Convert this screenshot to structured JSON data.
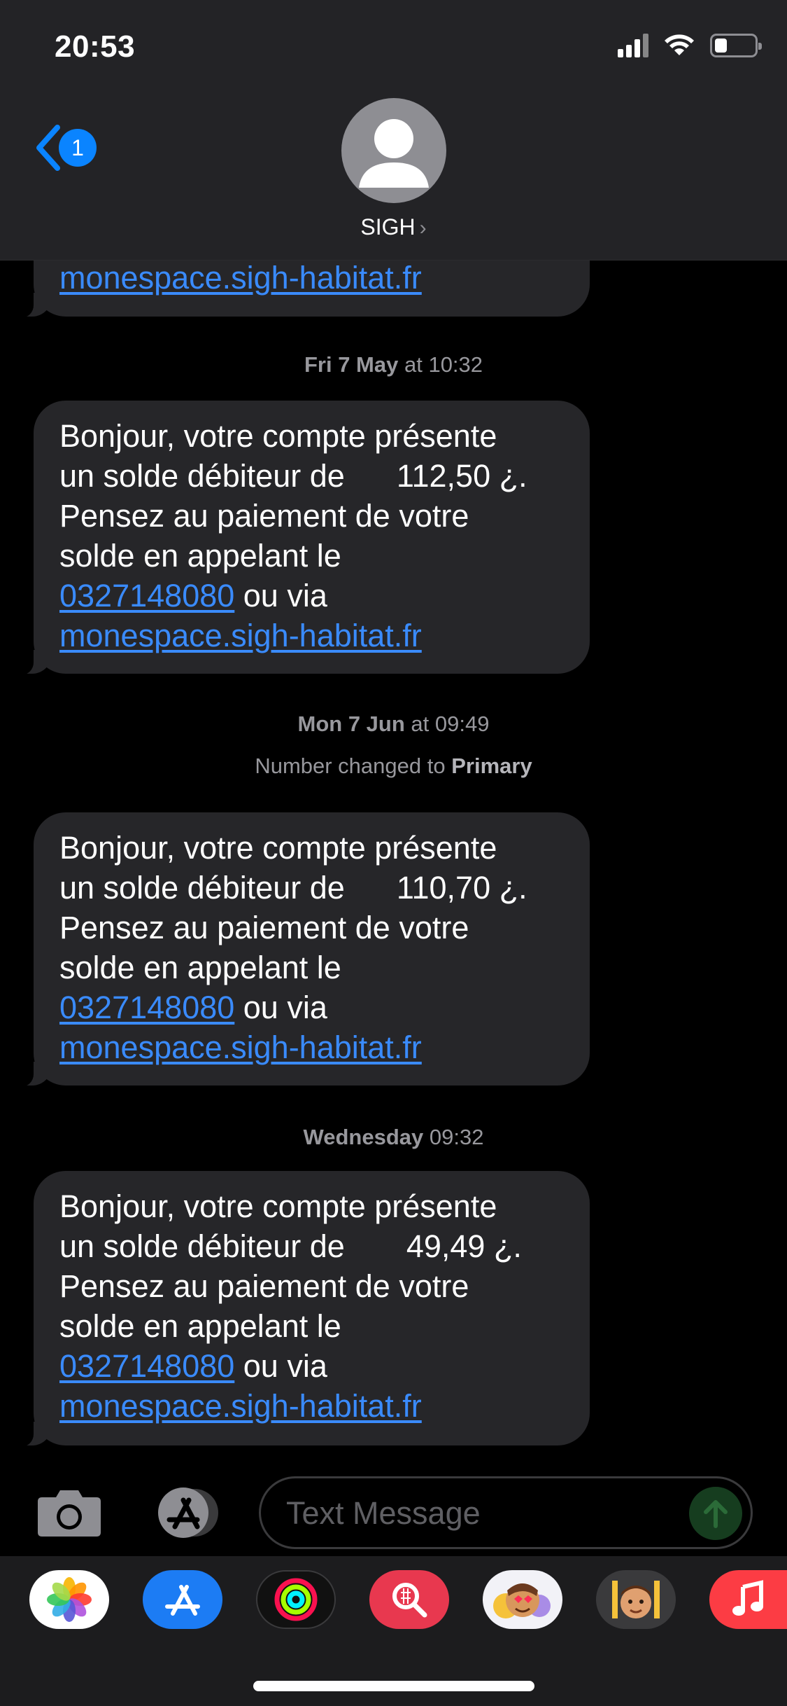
{
  "status_bar": {
    "time": "20:53",
    "icons": [
      "cellular-signal-icon",
      "wifi-icon",
      "battery-icon"
    ],
    "battery_level_fraction": 0.3
  },
  "nav": {
    "back_icon": "chevron-left-icon",
    "unread_badge": "1",
    "contact_name": "SIGH",
    "contact_chevron": "›"
  },
  "conversation": {
    "partial_top": {
      "link_site": "monespace.sigh-habitat.fr"
    },
    "groups": [
      {
        "timestamp_day": "Fri 7 May",
        "timestamp_at": " at ",
        "timestamp_time": "10:32",
        "message": {
          "line1": "Bonjour, votre compte présente",
          "line2_prefix": "un solde débiteur de",
          "amount": "112,50 ¿.",
          "line3": "Pensez au paiement de votre",
          "line4": "solde en appelant le",
          "phone": "0327148080",
          "ou_via": " ou via",
          "site": "monespace.sigh-habitat.fr"
        }
      },
      {
        "timestamp_day": "Mon 7 Jun",
        "timestamp_at": " at ",
        "timestamp_time": "09:49",
        "note_prefix": "Number changed to ",
        "note_value": "Primary",
        "message": {
          "line1": "Bonjour, votre compte présente",
          "line2_prefix": "un solde débiteur de",
          "amount": "110,70 ¿.",
          "line3": "Pensez au paiement de votre",
          "line4": "solde en appelant le",
          "phone": "0327148080",
          "ou_via": " ou via",
          "site": "monespace.sigh-habitat.fr"
        }
      },
      {
        "timestamp_day": "Wednesday",
        "timestamp_at": " ",
        "timestamp_time": "09:32",
        "message": {
          "line1": "Bonjour, votre compte présente",
          "line2_prefix": "un solde débiteur de",
          "amount": "49,49 ¿.",
          "line3": "Pensez au paiement de votre",
          "line4": "solde en appelant le",
          "phone": "0327148080",
          "ou_via": " ou via",
          "site": "monespace.sigh-habitat.fr"
        }
      }
    ]
  },
  "compose": {
    "placeholder": "Text Message",
    "camera_icon": "camera-icon",
    "apps_icon": "app-store-icon",
    "send_icon": "send-arrow-up-icon"
  },
  "app_strip": {
    "apps": [
      "photos-icon",
      "app-store-icon",
      "activity-icon",
      "image-search-icon",
      "animoji-icon",
      "memoji-icon",
      "music-icon"
    ]
  },
  "colors": {
    "header_bg": "#232326",
    "bubble_bg": "#262629",
    "link": "#3a8bfd",
    "accent_blue": "#0a84ff",
    "timestamp": "#98989d"
  }
}
